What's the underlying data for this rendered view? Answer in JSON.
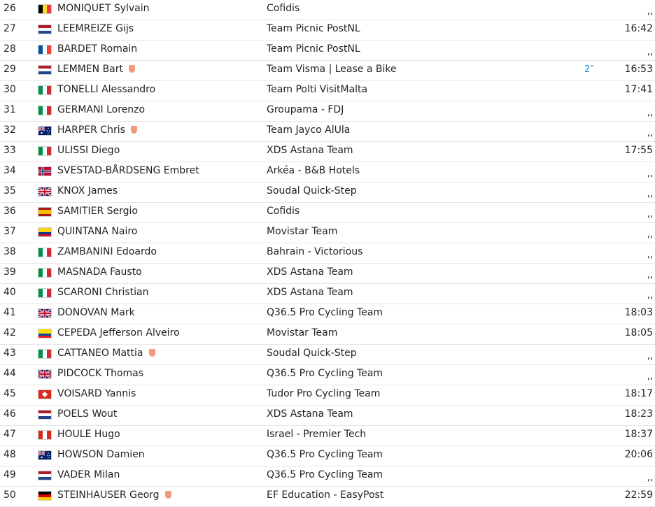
{
  "results": [
    {
      "rank": "26",
      "flag": "be",
      "name": "MONIQUET Sylvain",
      "team": "Cofidis",
      "bonus": "",
      "time": ",,",
      "badge": false
    },
    {
      "rank": "27",
      "flag": "nl",
      "name": "LEEMREIZE Gijs",
      "team": "Team Picnic PostNL",
      "bonus": "",
      "time": "16:42",
      "badge": false
    },
    {
      "rank": "28",
      "flag": "fr",
      "name": "BARDET Romain",
      "team": "Team Picnic PostNL",
      "bonus": "",
      "time": ",,",
      "badge": false
    },
    {
      "rank": "29",
      "flag": "nl",
      "name": "LEMMEN Bart",
      "team": "Team Visma | Lease a Bike",
      "bonus": "2″",
      "time": "16:53",
      "badge": true
    },
    {
      "rank": "30",
      "flag": "it",
      "name": "TONELLI Alessandro",
      "team": "Team Polti VisitMalta",
      "bonus": "",
      "time": "17:41",
      "badge": false
    },
    {
      "rank": "31",
      "flag": "it",
      "name": "GERMANI Lorenzo",
      "team": "Groupama - FDJ",
      "bonus": "",
      "time": ",,",
      "badge": false
    },
    {
      "rank": "32",
      "flag": "au",
      "name": "HARPER Chris",
      "team": "Team Jayco AlUla",
      "bonus": "",
      "time": ",,",
      "badge": true
    },
    {
      "rank": "33",
      "flag": "it",
      "name": "ULISSI Diego",
      "team": "XDS Astana Team",
      "bonus": "",
      "time": "17:55",
      "badge": false
    },
    {
      "rank": "34",
      "flag": "no",
      "name": "SVESTAD-BÅRDSENG Embret",
      "team": "Arkéa - B&B Hotels",
      "bonus": "",
      "time": ",,",
      "badge": false
    },
    {
      "rank": "35",
      "flag": "gb",
      "name": "KNOX James",
      "team": "Soudal Quick-Step",
      "bonus": "",
      "time": ",,",
      "badge": false
    },
    {
      "rank": "36",
      "flag": "es",
      "name": "SAMITIER Sergio",
      "team": "Cofidis",
      "bonus": "",
      "time": ",,",
      "badge": false
    },
    {
      "rank": "37",
      "flag": "co",
      "name": "QUINTANA Nairo",
      "team": "Movistar Team",
      "bonus": "",
      "time": ",,",
      "badge": false
    },
    {
      "rank": "38",
      "flag": "it",
      "name": "ZAMBANINI Edoardo",
      "team": "Bahrain - Victorious",
      "bonus": "",
      "time": ",,",
      "badge": false
    },
    {
      "rank": "39",
      "flag": "it",
      "name": "MASNADA Fausto",
      "team": "XDS Astana Team",
      "bonus": "",
      "time": ",,",
      "badge": false
    },
    {
      "rank": "40",
      "flag": "it",
      "name": "SCARONI Christian",
      "team": "XDS Astana Team",
      "bonus": "",
      "time": ",,",
      "badge": false
    },
    {
      "rank": "41",
      "flag": "gb",
      "name": "DONOVAN Mark",
      "team": "Q36.5 Pro Cycling Team",
      "bonus": "",
      "time": "18:03",
      "badge": false
    },
    {
      "rank": "42",
      "flag": "ec",
      "name": "CEPEDA Jefferson Alveiro",
      "team": "Movistar Team",
      "bonus": "",
      "time": "18:05",
      "badge": false
    },
    {
      "rank": "43",
      "flag": "it",
      "name": "CATTANEO Mattia",
      "team": "Soudal Quick-Step",
      "bonus": "",
      "time": ",,",
      "badge": true
    },
    {
      "rank": "44",
      "flag": "gb",
      "name": "PIDCOCK Thomas",
      "team": "Q36.5 Pro Cycling Team",
      "bonus": "",
      "time": ",,",
      "badge": false
    },
    {
      "rank": "45",
      "flag": "ch",
      "name": "VOISARD Yannis",
      "team": "Tudor Pro Cycling Team",
      "bonus": "",
      "time": "18:17",
      "badge": false
    },
    {
      "rank": "46",
      "flag": "nl",
      "name": "POELS Wout",
      "team": "XDS Astana Team",
      "bonus": "",
      "time": "18:23",
      "badge": false
    },
    {
      "rank": "47",
      "flag": "ca",
      "name": "HOULE Hugo",
      "team": "Israel - Premier Tech",
      "bonus": "",
      "time": "18:37",
      "badge": false
    },
    {
      "rank": "48",
      "flag": "au",
      "name": "HOWSON Damien",
      "team": "Q36.5 Pro Cycling Team",
      "bonus": "",
      "time": "20:06",
      "badge": false
    },
    {
      "rank": "49",
      "flag": "nl",
      "name": "VADER Milan",
      "team": "Q36.5 Pro Cycling Team",
      "bonus": "",
      "time": ",,",
      "badge": false
    },
    {
      "rank": "50",
      "flag": "de",
      "name": "STEINHAUSER Georg",
      "team": "EF Education - EasyPost",
      "bonus": "",
      "time": "22:59",
      "badge": true
    }
  ],
  "colors": {
    "bonus": "#1a8ad6",
    "badge": "#f2997a",
    "divider": "#e6e6e6"
  }
}
